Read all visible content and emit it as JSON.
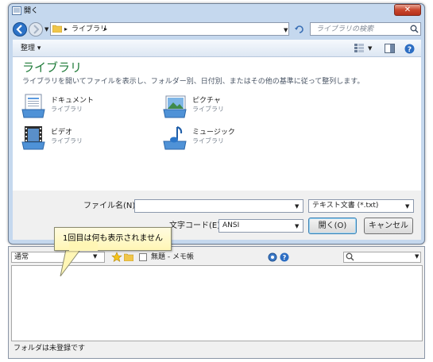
{
  "window": {
    "title": "開く",
    "close_label": "✕"
  },
  "address": {
    "path": "ライブラリ",
    "separator_left": "▸",
    "separator_right": "▸"
  },
  "search": {
    "placeholder": "ライブラリの検索"
  },
  "toolbar": {
    "organize_label": "整理 ▾"
  },
  "library": {
    "title": "ライブラリ",
    "description": "ライブラリを開いてファイルを表示し、フォルダー別、日付別、またはその他の基準に従って整列します。",
    "items": [
      {
        "name": "ドキュメント",
        "type": "ライブラリ"
      },
      {
        "name": "ピクチャ",
        "type": "ライブラリ"
      },
      {
        "name": "ビデオ",
        "type": "ライブラリ"
      },
      {
        "name": "ミュージック",
        "type": "ライブラリ"
      }
    ]
  },
  "form": {
    "filename_label": "ファイル名(N):",
    "filename_value": "",
    "filter_value": "テキスト文書 (*.txt)",
    "encoding_label": "文字コード(E):",
    "encoding_value": "ANSI",
    "open_label": "開く(O)",
    "cancel_label": "キャンセル"
  },
  "tooltip": {
    "text": "1回目は何も表示されません"
  },
  "memo_app": {
    "combo_value": "通常",
    "tab_label": "無題 - メモ帳",
    "status_text": "フォルダは未登録です"
  },
  "colors": {
    "library_title": "#1e7a38",
    "close_button": "#c9462c",
    "dialog_frame": "#c5d8ee"
  }
}
